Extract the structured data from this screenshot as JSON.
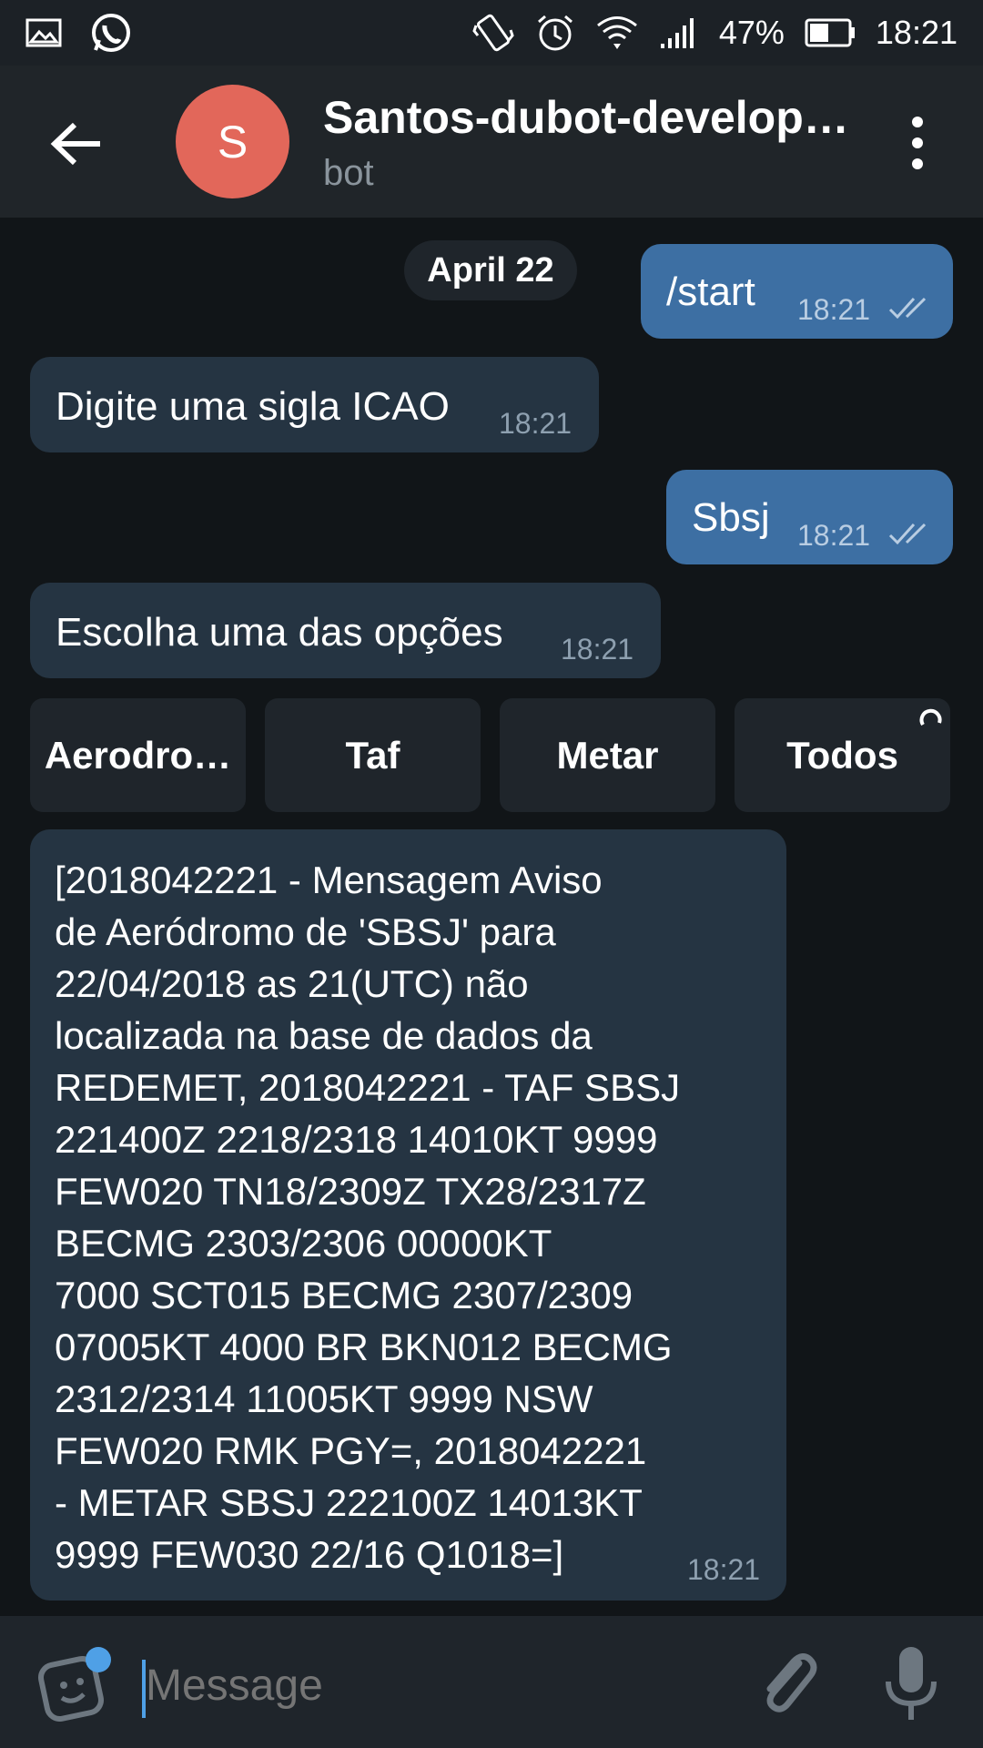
{
  "status_bar": {
    "battery": "47%",
    "time": "18:21",
    "left_icons": [
      "gallery-icon",
      "whatsapp-icon"
    ],
    "right_icons": [
      "vibrate-icon",
      "alarm-icon",
      "wifi-icon",
      "signal-icon",
      "battery-icon"
    ]
  },
  "header": {
    "avatar_letter": "S",
    "avatar_color": "#e2675a",
    "title": "Santos-dubot-develop…",
    "subtitle": "bot"
  },
  "chat": {
    "date": "April 22",
    "messages": [
      {
        "direction": "out",
        "text": "/start",
        "time": "18:21"
      },
      {
        "direction": "in",
        "text": "Digite uma sigla ICAO",
        "time": "18:21"
      },
      {
        "direction": "out",
        "text": "Sbsj",
        "time": "18:21"
      },
      {
        "direction": "in",
        "text": "Escolha uma das opções",
        "time": "18:21"
      },
      {
        "direction": "in",
        "text": "[2018042221 - Mensagem Aviso\nde Aeródromo de 'SBSJ' para\n22/04/2018 as 21(UTC) não\nlocalizada na base de dados da\nREDEMET, 2018042221 - TAF SBSJ\n221400Z 2218/2318 14010KT 9999\nFEW020 TN18/2309Z TX28/2317Z\nBECMG 2303/2306 00000KT\n7000 SCT015 BECMG 2307/2309\n07005KT 4000 BR BKN012 BECMG\n2312/2314 11005KT 9999 NSW\nFEW020 RMK PGY=, 2018042221\n- METAR SBSJ 222100Z 14013KT\n9999 FEW030 22/16 Q1018=]",
        "time": "18:21"
      }
    ],
    "keyboard_buttons": [
      "Aerodro…",
      "Taf",
      "Metar",
      "Todos"
    ]
  },
  "input": {
    "placeholder": "Message"
  },
  "colors": {
    "outgoing_bubble": "#3d6fa3",
    "incoming_bubble": "#253442",
    "background": "#111518",
    "accent": "#4fa0e6"
  }
}
